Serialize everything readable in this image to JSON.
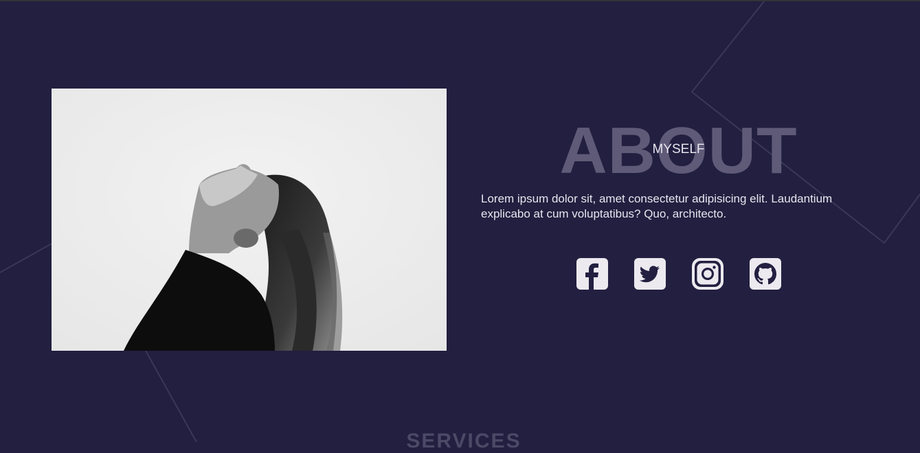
{
  "about": {
    "title_big": "ABOUT",
    "title_small": "MYSELF",
    "text": "Lorem ipsum dolor sit, amet consectetur adipisicing elit. Laudantium explicabo at cum voluptatibus? Quo, architecto."
  },
  "socials": [
    {
      "icon": "facebook-icon"
    },
    {
      "icon": "twitter-icon"
    },
    {
      "icon": "instagram-icon"
    },
    {
      "icon": "github-icon"
    }
  ],
  "services": {
    "title": "SERVICES"
  },
  "colors": {
    "background": "#221f40",
    "heading_watermark": "#5f5a77",
    "text": "#e7e6ee",
    "icon": "#ece9ef"
  }
}
